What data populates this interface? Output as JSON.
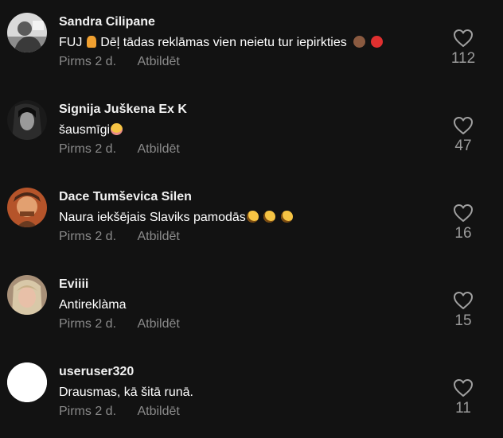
{
  "comments": [
    {
      "username": "Sandra Cilipane",
      "text_main": "FUJ",
      "text_rest": "Dēļ tādas reklāmas vien neietu tur iepirkties",
      "time": "Pirms 2 d.",
      "reply_label": "Atbildēt",
      "likes": "112",
      "avatar_icon": "avatar-photo-icon",
      "emoji_icons": [
        "person-emoji-icon",
        "see-no-evil-monkey-emoji-icon",
        "angry-face-emoji-icon"
      ]
    },
    {
      "username": "Signija Juškena Ex K",
      "text_main": "šausmīgi",
      "text_rest": "",
      "time": "Pirms 2 d.",
      "reply_label": "Atbildēt",
      "likes": "47",
      "avatar_icon": "avatar-photo-icon",
      "emoji_icons": [
        "flushed-face-emoji-icon"
      ]
    },
    {
      "username": "Dace Tumševica Silen",
      "text_main": "Naura iekšējais Slaviks pamodās",
      "text_rest": "",
      "time": "Pirms 2 d.",
      "reply_label": "Atbildēt",
      "likes": "16",
      "avatar_icon": "avatar-photo-icon",
      "emoji_icons": [
        "rolling-laughing-emoji-icon",
        "rolling-laughing-emoji-icon",
        "rolling-laughing-emoji-icon"
      ]
    },
    {
      "username": "Eviiii",
      "text_main": "Antireklàma",
      "text_rest": "",
      "time": "Pirms 2 d.",
      "reply_label": "Atbildēt",
      "likes": "15",
      "avatar_icon": "avatar-photo-icon",
      "emoji_icons": []
    },
    {
      "username": "useruser320",
      "text_main": "Drausmas, kā šitā runā.",
      "text_rest": "",
      "time": "Pirms 2 d.",
      "reply_label": "Atbildēt",
      "likes": "11",
      "avatar_icon": "avatar-placeholder-icon",
      "emoji_icons": []
    }
  ],
  "colors": {
    "background": "#121212",
    "username": "#f1f1f1",
    "text": "#ffffff",
    "meta": "#8a8a8a",
    "like_count": "#9a9a9a"
  }
}
